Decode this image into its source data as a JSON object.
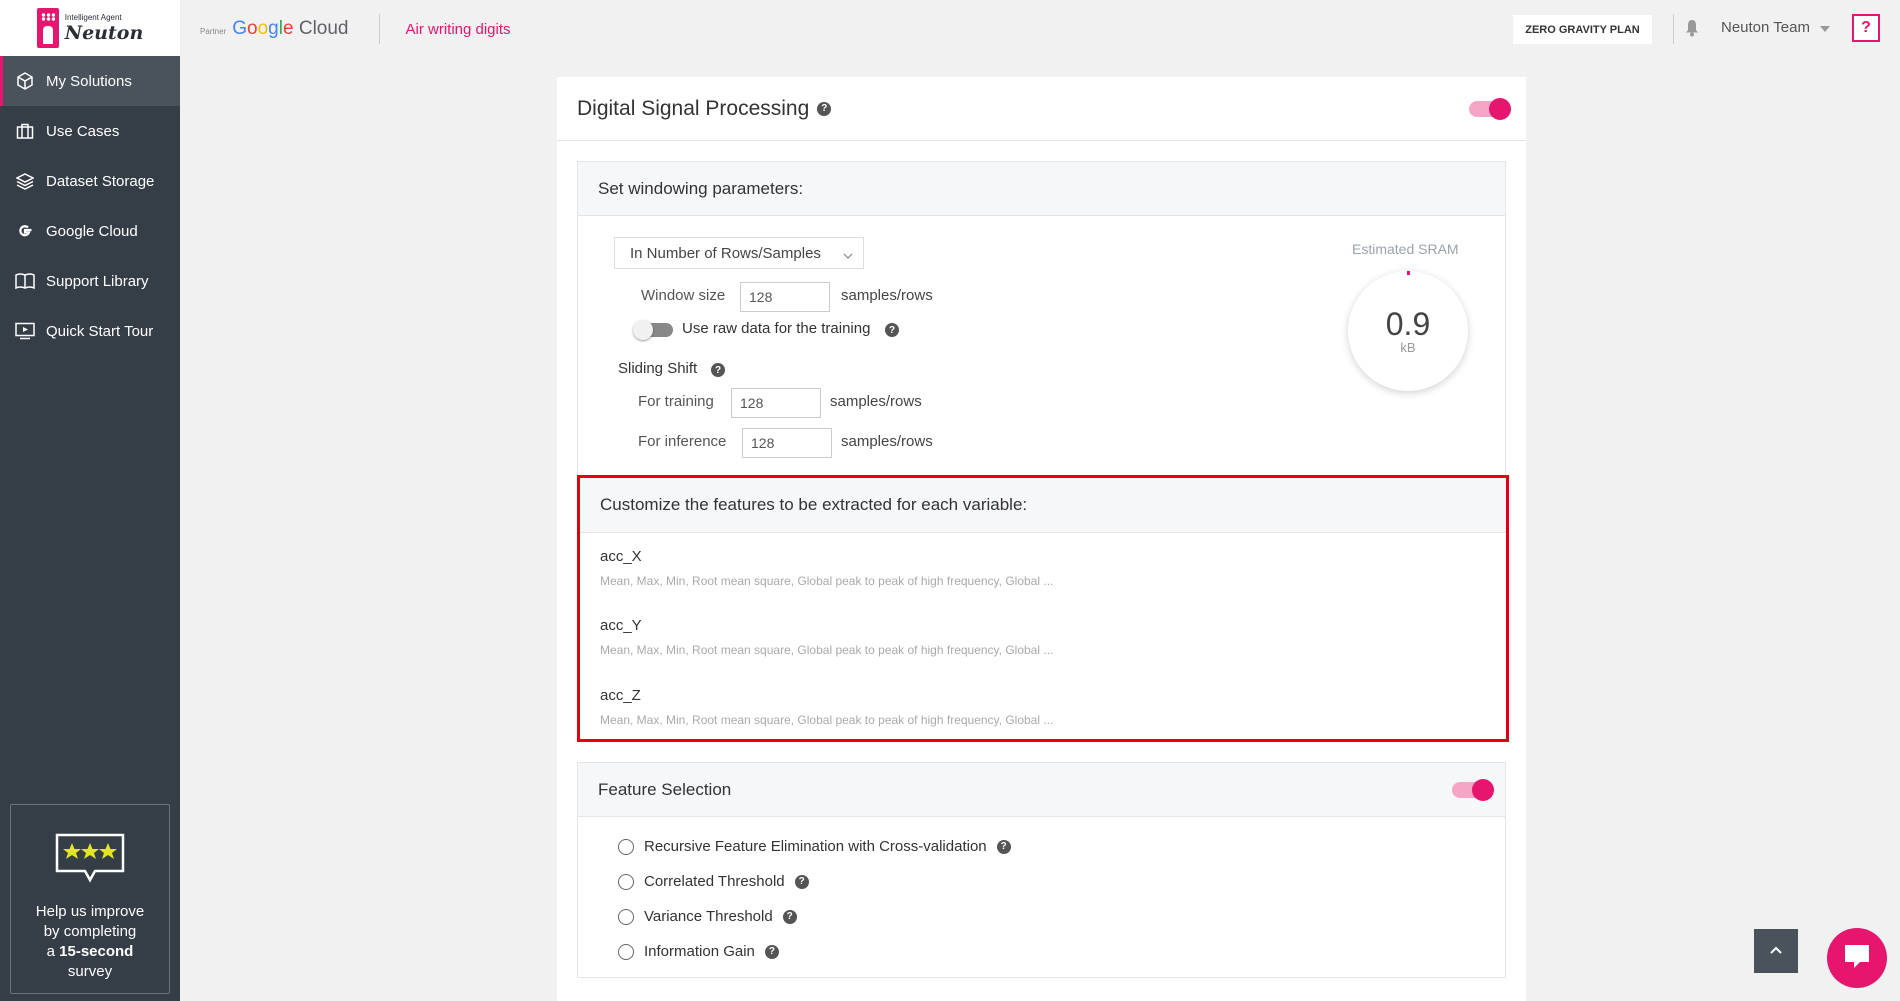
{
  "brand": {
    "small": "Intelligent Agent",
    "name": "Neuton"
  },
  "sidebar": {
    "items": [
      {
        "label": "My Solutions",
        "icon": "cube-icon"
      },
      {
        "label": "Use Cases",
        "icon": "briefcase-icon"
      },
      {
        "label": "Dataset Storage",
        "icon": "layers-icon"
      },
      {
        "label": "Google Cloud",
        "icon": "google-icon"
      },
      {
        "label": "Support Library",
        "icon": "book-icon"
      },
      {
        "label": "Quick Start Tour",
        "icon": "play-screen-icon"
      }
    ],
    "survey": {
      "line1": "Help us improve",
      "line2": "by completing",
      "line3a": "a ",
      "line3b": "15-second",
      "line4": "survey"
    }
  },
  "topbar": {
    "partner_label": "Partner",
    "cloud_label": "Cloud",
    "solution_name": "Air writing digits",
    "plan_label": "ZERO GRAVITY PLAN",
    "user_name": "Neuton Team",
    "help_label": "?"
  },
  "dsp": {
    "title": "Digital Signal Processing",
    "windowing": {
      "heading": "Set windowing parameters:",
      "mode": "In Number of Rows/Samples",
      "window_size_label": "Window size",
      "window_size": "128",
      "unit": "samples/rows",
      "raw_data_label": "Use raw data for the training",
      "sliding_shift_label": "Sliding Shift",
      "for_training_label": "For training",
      "for_training": "128",
      "for_inference_label": "For inference",
      "for_inference": "128",
      "sram_label": "Estimated SRAM",
      "sram_value": "0.9",
      "sram_unit": "kB"
    },
    "features": {
      "heading": "Customize the features to be extracted for each variable:",
      "variables": [
        {
          "name": "acc_X",
          "summary": "Mean, Max, Min, Root mean square, Global peak to peak of high frequency, Global ..."
        },
        {
          "name": "acc_Y",
          "summary": "Mean, Max, Min, Root mean square, Global peak to peak of high frequency, Global ..."
        },
        {
          "name": "acc_Z",
          "summary": "Mean, Max, Min, Root mean square, Global peak to peak of high frequency, Global ..."
        }
      ]
    },
    "selection": {
      "heading": "Feature Selection",
      "options": [
        "Recursive Feature Elimination with Cross-validation",
        "Correlated Threshold",
        "Variance Threshold",
        "Information Gain"
      ]
    }
  },
  "colors": {
    "accent": "#e6166e",
    "sidebar": "#353d47",
    "highlight": "#e3000f"
  }
}
